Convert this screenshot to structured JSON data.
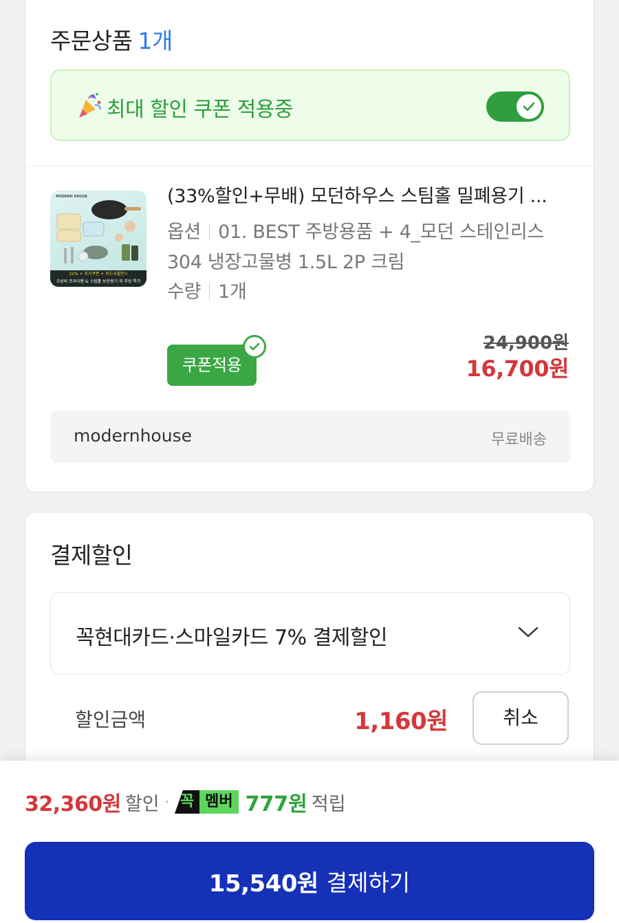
{
  "order": {
    "title": "주문상품",
    "count": "1개",
    "coupon_banner": "최대 할인 쿠폰 적용중",
    "coupon_toggle_on": true,
    "product": {
      "name": "(33%할인+무배) 모던하우스 스팀홀 밀폐용기 ...",
      "option_label": "옵션",
      "option_value_line1": "01. BEST 주방용품 + 4_모던 스테인리스",
      "option_value_line2": "304 냉장고물병 1.5L 2P 크림",
      "quantity_label": "수량",
      "quantity_value": "1개",
      "thumb_brand": "MODERN HOUSE",
      "thumb_banner_line1": "22% + 추가쿠폰 + 카드사할인!!",
      "thumb_banner_line2": "가성비 프라이팬 & 스팀홀 보관용기 외 주방 특가",
      "coupon_badge": "쿠폰적용",
      "original_price": "24,900원",
      "sale_price": "16,700원"
    },
    "seller": {
      "name": "modernhouse",
      "shipping": "무료배송"
    }
  },
  "payment_discount": {
    "title": "결제할인",
    "selected_option": "꼭현대카드·스마일카드 7% 결제할인",
    "discount_label": "할인금액",
    "discount_amount": "1,160원",
    "cancel_label": "취소"
  },
  "bottom": {
    "discount_total": "32,360원",
    "discount_word": "할인",
    "dot": "·",
    "member_badge_left": "꼭",
    "member_badge_right": "멤버",
    "points": "777원",
    "points_word": "적립",
    "pay_amount": "15,540원",
    "pay_label": "결제하기"
  },
  "colors": {
    "accent_blue": "#1531b8",
    "sale_red": "#d4373b",
    "coupon_green": "#3aa744",
    "count_blue": "#2f7bea"
  }
}
